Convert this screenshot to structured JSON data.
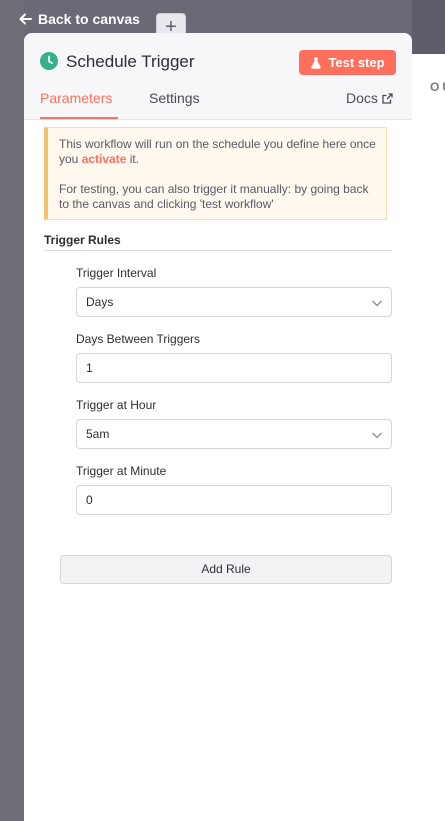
{
  "topbar": {
    "back_label": "Back to canvas",
    "plus_symbol": "+"
  },
  "output_label": "OU",
  "node": {
    "title": "Schedule Trigger",
    "icon": "clock-icon",
    "test_label": "Test step",
    "accent": "#ff6f5c"
  },
  "tabs": {
    "parameters": "Parameters",
    "settings": "Settings",
    "docs": "Docs"
  },
  "notice": {
    "line1_prefix": "This workflow will run on the schedule you define here once you ",
    "line1_link": "activate",
    "line1_suffix": " it.",
    "line2": "For testing, you can also trigger it manually: by going back to the canvas and clicking 'test workflow'"
  },
  "rules": {
    "title": "Trigger Rules",
    "fields": [
      {
        "label": "Trigger Interval",
        "value": "Days"
      },
      {
        "label": "Days Between Triggers",
        "value": "1"
      },
      {
        "label": "Trigger at Hour",
        "value": "5am"
      },
      {
        "label": "Trigger at Minute",
        "value": "0"
      }
    ],
    "add_rule_label": "Add Rule"
  }
}
